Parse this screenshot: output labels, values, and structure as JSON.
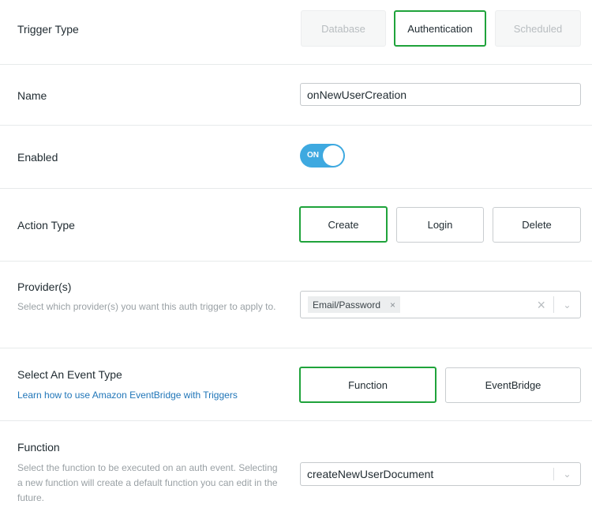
{
  "trigger_type": {
    "label": "Trigger Type",
    "options": [
      "Database",
      "Authentication",
      "Scheduled"
    ],
    "selected": "Authentication"
  },
  "name": {
    "label": "Name",
    "value": "onNewUserCreation"
  },
  "enabled": {
    "label": "Enabled",
    "state": "ON",
    "color": "#3ea9e0"
  },
  "action_type": {
    "label": "Action Type",
    "options": [
      "Create",
      "Login",
      "Delete"
    ],
    "selected": "Create"
  },
  "providers": {
    "label": "Provider(s)",
    "description": "Select which provider(s) you want this auth trigger to apply to.",
    "chips": [
      "Email/Password"
    ],
    "chip_remove": "×",
    "clear": "×"
  },
  "event_type": {
    "label": "Select An Event Type",
    "link": "Learn how to use Amazon EventBridge with Triggers",
    "options": [
      "Function",
      "EventBridge"
    ],
    "selected": "Function"
  },
  "function": {
    "label": "Function",
    "description": "Select the function to be executed on an auth event. Selecting a new function will create a default function you can edit in the future.",
    "value": "createNewUserDocument"
  },
  "accent": "#1fa33b"
}
